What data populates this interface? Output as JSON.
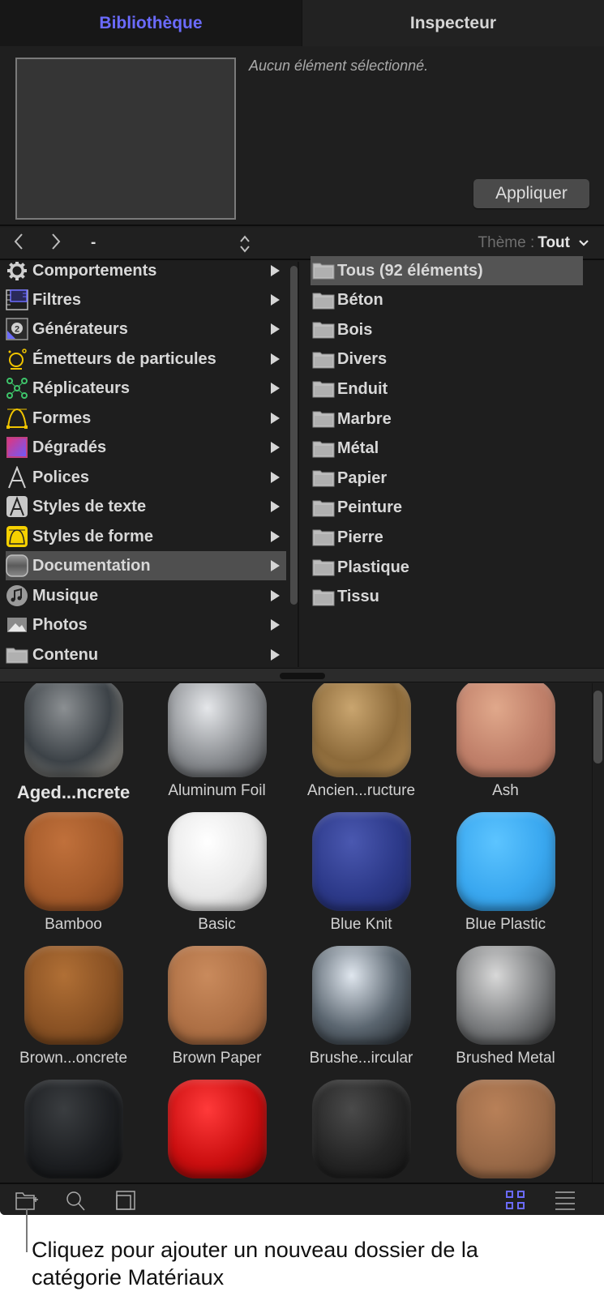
{
  "tabs": [
    {
      "label": "Bibliothèque",
      "active": true
    },
    {
      "label": "Inspecteur",
      "active": false
    }
  ],
  "preview": {
    "status_text": "Aucun élément sélectionné.",
    "apply_label": "Appliquer"
  },
  "nav": {
    "back_icon": "chevron-left-icon",
    "forward_icon": "chevron-right-icon",
    "path": "-",
    "theme_label": "Thème :",
    "theme_value": "Tout"
  },
  "categories": [
    {
      "label": "Comportements",
      "icon": "gear-icon",
      "selected": false
    },
    {
      "label": "Filtres",
      "icon": "filter-filmstrip-icon",
      "selected": false
    },
    {
      "label": "Générateurs",
      "icon": "generator-icon",
      "selected": false
    },
    {
      "label": "Émetteurs de particules",
      "icon": "particle-emitter-icon",
      "selected": false
    },
    {
      "label": "Réplicateurs",
      "icon": "replicator-icon",
      "selected": false
    },
    {
      "label": "Formes",
      "icon": "shape-bezier-icon",
      "selected": false
    },
    {
      "label": "Dégradés",
      "icon": "gradient-icon",
      "selected": false
    },
    {
      "label": "Polices",
      "icon": "font-icon",
      "selected": false
    },
    {
      "label": "Styles de texte",
      "icon": "text-style-icon",
      "selected": false
    },
    {
      "label": "Styles de forme",
      "icon": "shape-style-icon",
      "selected": false
    },
    {
      "label": "Documentation",
      "icon": "material-icon",
      "selected": true
    },
    {
      "label": "Musique",
      "icon": "music-icon",
      "selected": false
    },
    {
      "label": "Photos",
      "icon": "photo-icon",
      "selected": false
    },
    {
      "label": "Contenu",
      "icon": "folder-icon",
      "selected": false
    }
  ],
  "folders": [
    {
      "label": "Tous (92 éléments)",
      "selected": true
    },
    {
      "label": "Béton",
      "selected": false
    },
    {
      "label": "Bois",
      "selected": false
    },
    {
      "label": "Divers",
      "selected": false
    },
    {
      "label": "Enduit",
      "selected": false
    },
    {
      "label": "Marbre",
      "selected": false
    },
    {
      "label": "Métal",
      "selected": false
    },
    {
      "label": "Papier",
      "selected": false
    },
    {
      "label": "Peinture",
      "selected": false
    },
    {
      "label": "Pierre",
      "selected": false
    },
    {
      "label": "Plastique",
      "selected": false
    },
    {
      "label": "Tissu",
      "selected": false
    }
  ],
  "materials": [
    {
      "label": "Aged...ncrete",
      "bold": true,
      "colors": [
        "#8b8f92",
        "#3c4247",
        "#a09a8f"
      ]
    },
    {
      "label": "Aluminum Foil",
      "bold": false,
      "colors": [
        "#e5e7ea",
        "#8a8d91",
        "#3a3c3f"
      ]
    },
    {
      "label": "Ancien...ructure",
      "bold": false,
      "colors": [
        "#c9a56f",
        "#8c6a3a",
        "#b48c54"
      ]
    },
    {
      "label": "Ash",
      "bold": false,
      "colors": [
        "#e0a88b",
        "#c0806a",
        "#a96a55"
      ]
    },
    {
      "label": "Bamboo",
      "bold": false,
      "colors": [
        "#c0703b",
        "#a35a2a",
        "#7a3f1b"
      ]
    },
    {
      "label": "Basic",
      "bold": false,
      "colors": [
        "#ffffff",
        "#e8e8e8",
        "#a8a8a8"
      ]
    },
    {
      "label": "Blue Knit",
      "bold": false,
      "colors": [
        "#4a58b0",
        "#2d3a8a",
        "#1d2766"
      ]
    },
    {
      "label": "Blue Plastic",
      "bold": false,
      "colors": [
        "#5cc4ff",
        "#3aa8f0",
        "#2480c0"
      ]
    },
    {
      "label": "Brown...oncrete",
      "bold": false,
      "colors": [
        "#b06f35",
        "#8a5224",
        "#5a3414"
      ]
    },
    {
      "label": "Brown Paper",
      "bold": false,
      "colors": [
        "#c98a5c",
        "#ae7045",
        "#7c4c2c"
      ]
    },
    {
      "label": "Brushe...ircular",
      "bold": false,
      "colors": [
        "#dfe6ee",
        "#5b6670",
        "#1d2227"
      ]
    },
    {
      "label": "Brushed Metal",
      "bold": false,
      "colors": [
        "#d8d8d8",
        "#7a7c7e",
        "#2a2b2c"
      ]
    },
    {
      "label": "",
      "bold": false,
      "colors": [
        "#3a3d40",
        "#1d1f22",
        "#0e0f10"
      ]
    },
    {
      "label": "",
      "bold": false,
      "colors": [
        "#ff3a3a",
        "#cc0f10",
        "#7a0000"
      ]
    },
    {
      "label": "",
      "bold": false,
      "colors": [
        "#4a4a4a",
        "#252525",
        "#121212"
      ]
    },
    {
      "label": "",
      "bold": false,
      "colors": [
        "#b88058",
        "#9a6a48",
        "#7a5236"
      ]
    }
  ],
  "toolbar": {
    "new_folder_icon": "new-folder-icon",
    "search_icon": "search-icon",
    "preview_toggle_icon": "preview-toggle-icon",
    "grid_view_icon": "grid-view-icon",
    "list_view_icon": "list-view-icon",
    "accent": "#6b6bff"
  },
  "callout": {
    "text": "Cliquez pour ajouter un nouveau dossier de la catégorie Matériaux"
  }
}
